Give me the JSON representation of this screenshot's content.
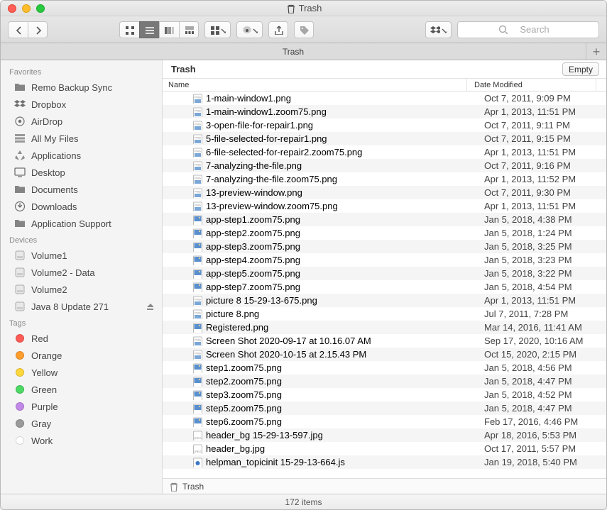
{
  "window": {
    "title": "Trash"
  },
  "toolbar": {
    "search_placeholder": "Search"
  },
  "tabbar": {
    "tab": "Trash"
  },
  "header": {
    "crumb": "Trash",
    "empty_label": "Empty"
  },
  "columns": {
    "name": "Name",
    "date": "Date Modified"
  },
  "sidebar": {
    "favorites_label": "Favorites",
    "devices_label": "Devices",
    "tags_label": "Tags",
    "favorites": [
      {
        "label": "Remo Backup Sync",
        "icon": "folder"
      },
      {
        "label": "Dropbox",
        "icon": "dropbox"
      },
      {
        "label": "AirDrop",
        "icon": "airdrop"
      },
      {
        "label": "All My Files",
        "icon": "allfiles"
      },
      {
        "label": "Applications",
        "icon": "apps"
      },
      {
        "label": "Desktop",
        "icon": "desktop"
      },
      {
        "label": "Documents",
        "icon": "folder"
      },
      {
        "label": "Downloads",
        "icon": "downloads"
      },
      {
        "label": "Application Support",
        "icon": "folder"
      }
    ],
    "devices": [
      {
        "label": "Volume1",
        "icon": "disk"
      },
      {
        "label": "Volume2 - Data",
        "icon": "disk"
      },
      {
        "label": "Volume2",
        "icon": "disk"
      },
      {
        "label": "Java 8 Update 271",
        "icon": "disk",
        "ejectable": true
      }
    ],
    "tags": [
      {
        "label": "Red",
        "color": "#ff5b56"
      },
      {
        "label": "Orange",
        "color": "#ff9e2d"
      },
      {
        "label": "Yellow",
        "color": "#ffd83d"
      },
      {
        "label": "Green",
        "color": "#4cd964"
      },
      {
        "label": "Purple",
        "color": "#c389e8"
      },
      {
        "label": "Gray",
        "color": "#9b9b9b"
      },
      {
        "label": "Work",
        "color": "#ffffff"
      }
    ]
  },
  "files": [
    {
      "name": "1-main-window1.png",
      "date": "Oct 7, 2011, 9:09 PM",
      "type": "png"
    },
    {
      "name": "1-main-window1.zoom75.png",
      "date": "Apr 1, 2013, 11:51 PM",
      "type": "png"
    },
    {
      "name": "3-open-file-for-repair1.png",
      "date": "Oct 7, 2011, 9:11 PM",
      "type": "png"
    },
    {
      "name": "5-file-selected-for-repair1.png",
      "date": "Oct 7, 2011, 9:15 PM",
      "type": "png"
    },
    {
      "name": "6-file-selected-for-repair2.zoom75.png",
      "date": "Apr 1, 2013, 11:51 PM",
      "type": "png"
    },
    {
      "name": "7-analyzing-the-file.png",
      "date": "Oct 7, 2011, 9:16 PM",
      "type": "png"
    },
    {
      "name": "7-analyzing-the-file.zoom75.png",
      "date": "Apr 1, 2013, 11:52 PM",
      "type": "png"
    },
    {
      "name": "13-preview-window.png",
      "date": "Oct 7, 2011, 9:30 PM",
      "type": "png"
    },
    {
      "name": "13-preview-window.zoom75.png",
      "date": "Apr 1, 2013, 11:51 PM",
      "type": "png"
    },
    {
      "name": "app-step1.zoom75.png",
      "date": "Jan 5, 2018, 4:38 PM",
      "type": "img"
    },
    {
      "name": "app-step2.zoom75.png",
      "date": "Jan 5, 2018, 1:24 PM",
      "type": "img"
    },
    {
      "name": "app-step3.zoom75.png",
      "date": "Jan 5, 2018, 3:25 PM",
      "type": "img"
    },
    {
      "name": "app-step4.zoom75.png",
      "date": "Jan 5, 2018, 3:23 PM",
      "type": "img"
    },
    {
      "name": "app-step5.zoom75.png",
      "date": "Jan 5, 2018, 3:22 PM",
      "type": "img"
    },
    {
      "name": "app-step7.zoom75.png",
      "date": "Jan 5, 2018, 4:54 PM",
      "type": "img"
    },
    {
      "name": "picture 8 15-29-13-675.png",
      "date": "Apr 1, 2013, 11:51 PM",
      "type": "png"
    },
    {
      "name": "picture 8.png",
      "date": "Jul 7, 2011, 7:28 PM",
      "type": "png"
    },
    {
      "name": "Registered.png",
      "date": "Mar 14, 2016, 11:41 AM",
      "type": "img"
    },
    {
      "name": "Screen Shot 2020-09-17 at 10.16.07 AM",
      "date": "Sep 17, 2020, 10:16 AM",
      "type": "png"
    },
    {
      "name": "Screen Shot 2020-10-15 at 2.15.43 PM",
      "date": "Oct 15, 2020, 2:15 PM",
      "type": "png"
    },
    {
      "name": "step1.zoom75.png",
      "date": "Jan 5, 2018, 4:56 PM",
      "type": "img"
    },
    {
      "name": "step2.zoom75.png",
      "date": "Jan 5, 2018, 4:47 PM",
      "type": "img"
    },
    {
      "name": "step3.zoom75.png",
      "date": "Jan 5, 2018, 4:52 PM",
      "type": "img"
    },
    {
      "name": "step5.zoom75.png",
      "date": "Jan 5, 2018, 4:47 PM",
      "type": "img"
    },
    {
      "name": "step6.zoom75.png",
      "date": "Feb 17, 2016, 4:46 PM",
      "type": "img"
    },
    {
      "name": "header_bg 15-29-13-597.jpg",
      "date": "Apr 18, 2016, 5:53 PM",
      "type": "jpg"
    },
    {
      "name": "header_bg.jpg",
      "date": "Oct 17, 2011, 5:57 PM",
      "type": "jpg"
    },
    {
      "name": "helpman_topicinit 15-29-13-664.js",
      "date": "Jan 19, 2018, 5:40 PM",
      "type": "js"
    }
  ],
  "pathbar": {
    "location": "Trash"
  },
  "status": {
    "text": "172 items"
  }
}
